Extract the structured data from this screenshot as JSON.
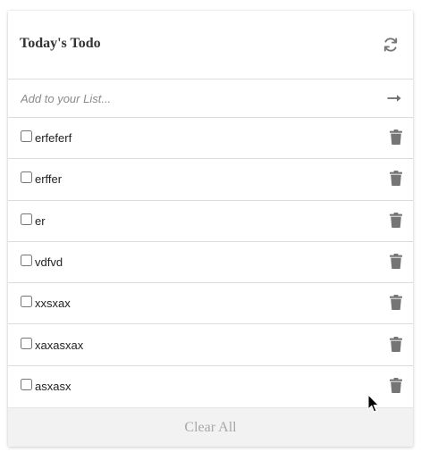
{
  "header": {
    "title": "Today's Todo",
    "refresh_icon": "refresh-icon"
  },
  "add": {
    "placeholder": "Add to your List...",
    "value": "",
    "submit_icon": "arrow-right-icon"
  },
  "todos": [
    {
      "label": "erfeferf",
      "checked": false
    },
    {
      "label": "erffer",
      "checked": false
    },
    {
      "label": "er",
      "checked": false
    },
    {
      "label": "vdfvd",
      "checked": false
    },
    {
      "label": "xxsxax",
      "checked": false
    },
    {
      "label": "xaxasxax",
      "checked": false
    },
    {
      "label": "asxasx",
      "checked": false
    }
  ],
  "footer": {
    "clear_label": "Clear All"
  },
  "colors": {
    "icon": "#777777",
    "trash": "#757575",
    "divider": "#dcdcdc",
    "footer_bg": "#f2f2f2",
    "footer_text": "#a8a8a8",
    "title": "#333333"
  }
}
